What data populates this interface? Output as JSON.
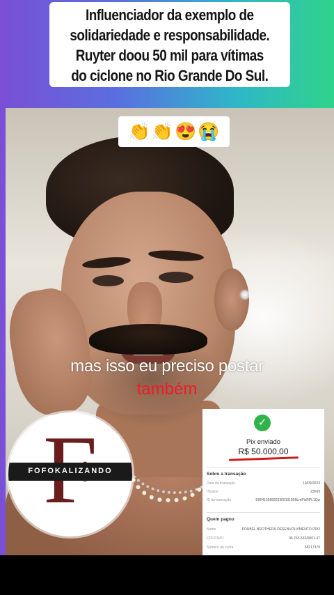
{
  "title": {
    "lines": [
      "Influenciador da exemplo de",
      "solidariedade e responsabilidade.",
      "Ruyter doou 50 mil para vítimas",
      "do ciclone no Rio Grande Do Sul."
    ],
    "emojis": [
      "👏",
      "👏",
      "😍",
      "😭"
    ]
  },
  "captions": {
    "line1": "mas isso eu preciso postar",
    "line2": "também"
  },
  "logo": {
    "letter": "F",
    "brand": "FOFOKALIZANDO"
  },
  "receipt": {
    "status": "Pix enviado",
    "amount": "R$ 50.000,00",
    "section_transaction": "Sobre a transação",
    "transaction_rows": [
      {
        "label": "Data da transação",
        "value": "10/09/2023"
      },
      {
        "label": "Horário",
        "value": "23h09"
      },
      {
        "label": "ID da transação",
        "value": "E00416968202309101509LmPixRPL1Cw"
      }
    ],
    "section_payer": "Quem pagou",
    "payer_rows": [
      {
        "label": "Nome",
        "value": "POUBEL BROTHERS DESENVOLVIMENTO PRO"
      },
      {
        "label": "CPF/CNPJ",
        "value": "36.763.532/0001-37"
      },
      {
        "label": "Número da conta",
        "value": "58217379"
      }
    ]
  }
}
